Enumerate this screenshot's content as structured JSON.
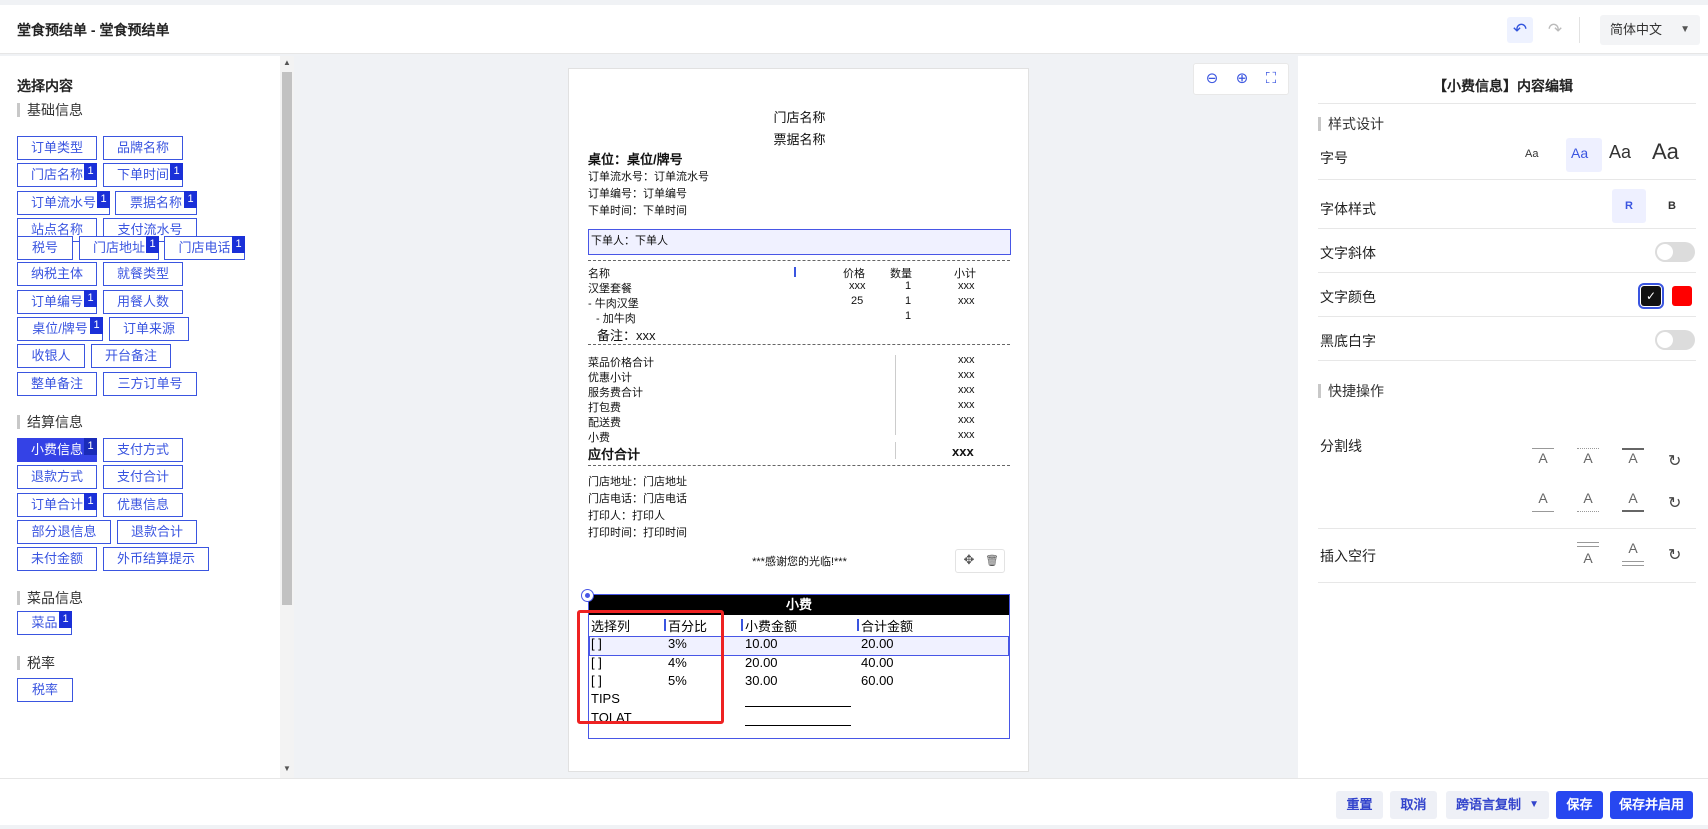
{
  "header": {
    "title": "堂食预结单 - 堂食预结单",
    "undo_icon": "↶",
    "redo_icon": "↷",
    "language": "简体中文"
  },
  "left": {
    "section_title": "选择内容",
    "groups": [
      {
        "title": "基础信息",
        "items": [
          {
            "label": "订单类型"
          },
          {
            "label": "品牌名称"
          },
          {
            "label": "门店名称",
            "badge": "1"
          },
          {
            "label": "下单时间",
            "badge": "1"
          },
          {
            "label": "订单流水号",
            "badge": "1"
          },
          {
            "label": "票据名称",
            "badge": "1"
          },
          {
            "label": "站点名称"
          },
          {
            "label": "支付流水号"
          },
          {
            "label": "税号"
          },
          {
            "label": "门店地址",
            "badge": "1"
          },
          {
            "label": "门店电话",
            "badge": "1"
          },
          {
            "label": "纳税主体"
          },
          {
            "label": "就餐类型"
          },
          {
            "label": "订单编号",
            "badge": "1"
          },
          {
            "label": "用餐人数"
          },
          {
            "label": "桌位/牌号",
            "badge": "1"
          },
          {
            "label": "订单来源"
          },
          {
            "label": "收银人"
          },
          {
            "label": "开台备注"
          },
          {
            "label": "整单备注"
          },
          {
            "label": "三方订单号"
          }
        ]
      },
      {
        "title": "结算信息",
        "items": [
          {
            "label": "小费信息",
            "badge": "1"
          },
          {
            "label": "支付方式"
          },
          {
            "label": "退款方式"
          },
          {
            "label": "支付合计"
          },
          {
            "label": "订单合计",
            "badge": "1"
          },
          {
            "label": "优惠信息"
          },
          {
            "label": "部分退信息"
          },
          {
            "label": "退款合计"
          },
          {
            "label": "未付金额"
          },
          {
            "label": "外币结算提示"
          }
        ]
      },
      {
        "title": "菜品信息",
        "items": [
          {
            "label": "菜品",
            "badge": "1"
          }
        ]
      },
      {
        "title": "税率",
        "items": [
          {
            "label": "税率"
          }
        ]
      }
    ]
  },
  "receipt": {
    "store_name": "门店名称",
    "ticket_name": "票据名称",
    "table": "桌位：桌位/牌号",
    "serial": "订单流水号：订单流水号",
    "order_no": "订单编号：订单编号",
    "order_time": "下单时间：下单时间",
    "orderer": "下单人：下单人",
    "cols": [
      "名称",
      "价格",
      "数量",
      "小计"
    ],
    "items": [
      {
        "name": "汉堡套餐",
        "price": "xxx",
        "qty": "1",
        "sub": "xxx"
      },
      {
        "name": "- 牛肉汉堡",
        "price": "25",
        "qty": "1",
        "sub": "xxx"
      },
      {
        "name": "- 加牛肉",
        "price": "",
        "qty": "1",
        "sub": ""
      }
    ],
    "remark": "备注：xxx",
    "totals": [
      {
        "label": "菜品价格合计",
        "value": "xxx"
      },
      {
        "label": "优惠小计",
        "value": "xxx"
      },
      {
        "label": "服务费合计",
        "value": "xxx"
      },
      {
        "label": "打包费",
        "value": "xxx"
      },
      {
        "label": "配送费",
        "value": "xxx"
      },
      {
        "label": "小费",
        "value": "xxx"
      }
    ],
    "due_label": "应付合计",
    "due_value": "xxx",
    "address": "门店地址：门店地址",
    "phone": "门店电话：门店电话",
    "printer": "打印人：打印人",
    "print_time": "打印时间：打印时间",
    "thanks": "***感谢您的光临!***",
    "tip": {
      "heading": "小费",
      "headers": [
        "选择列",
        "百分比",
        "小费金额",
        "合计金额"
      ],
      "rows": [
        {
          "sel": "[ ]",
          "pct": "3%",
          "tip": "10.00",
          "total": "20.00"
        },
        {
          "sel": "[ ]",
          "pct": "4%",
          "tip": "20.00",
          "total": "40.00"
        },
        {
          "sel": "[ ]",
          "pct": "5%",
          "tip": "30.00",
          "total": "60.00"
        }
      ],
      "tips_label": "TIPS",
      "total_label": "TOLAT"
    }
  },
  "canvas_tools": {
    "zoom_out_icon": "⊖",
    "zoom_in_icon": "⊕",
    "fit_icon": "⛶",
    "move_icon": "✥",
    "delete_icon": "🗑"
  },
  "right": {
    "title": "【小费信息】内容编辑",
    "style_group": "样式设计",
    "font_size_label": "字号",
    "font_sizes": [
      "Aa",
      "Aa",
      "Aa",
      "Aa"
    ],
    "font_style_label": "字体样式",
    "style_regular": "R",
    "style_bold": "B",
    "italic_label": "文字斜体",
    "color_label": "文字颜色",
    "inverse_label": "黑底白字",
    "quick_group": "快捷操作",
    "divider_label": "分割线",
    "divider_glyph": "A",
    "blank_label": "插入空行",
    "refresh_icon": "↻",
    "colors": {
      "black": "#111111",
      "red": "#ff0000"
    }
  },
  "footer": {
    "reset": "重置",
    "cancel": "取消",
    "copy_lang": "跨语言复制",
    "save": "保存",
    "save_enable": "保存并启用"
  }
}
